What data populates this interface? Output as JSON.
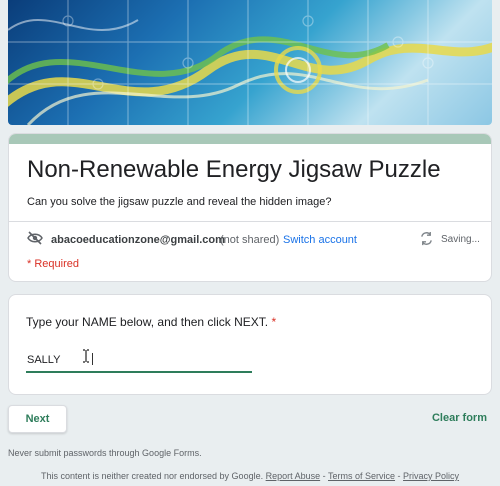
{
  "form": {
    "title": "Non-Renewable Energy Jigsaw Puzzle",
    "description": "Can you solve the jigsaw puzzle and reveal the hidden image?",
    "accent_color": "#2e7d5b",
    "required_note": "* Required"
  },
  "account": {
    "icon": "eye-off-icon",
    "email": "abacoeducationzone@gmail.com",
    "shared_status": "(not shared)",
    "switch_label": "Switch account",
    "sync_icon": "sync-icon",
    "status_text": "Saving..."
  },
  "question": {
    "label": "Type your NAME below, and then click NEXT.",
    "required_marker": "*",
    "value": "SALLY"
  },
  "actions": {
    "next_label": "Next",
    "clear_label": "Clear form"
  },
  "notes": {
    "passwords": "Never submit passwords through Google Forms."
  },
  "footer": {
    "text": "This content is neither created nor endorsed by Google.",
    "report_abuse": "Report Abuse",
    "sep1": " - ",
    "terms": "Terms of Service",
    "sep2": " - ",
    "privacy": "Privacy Policy"
  }
}
